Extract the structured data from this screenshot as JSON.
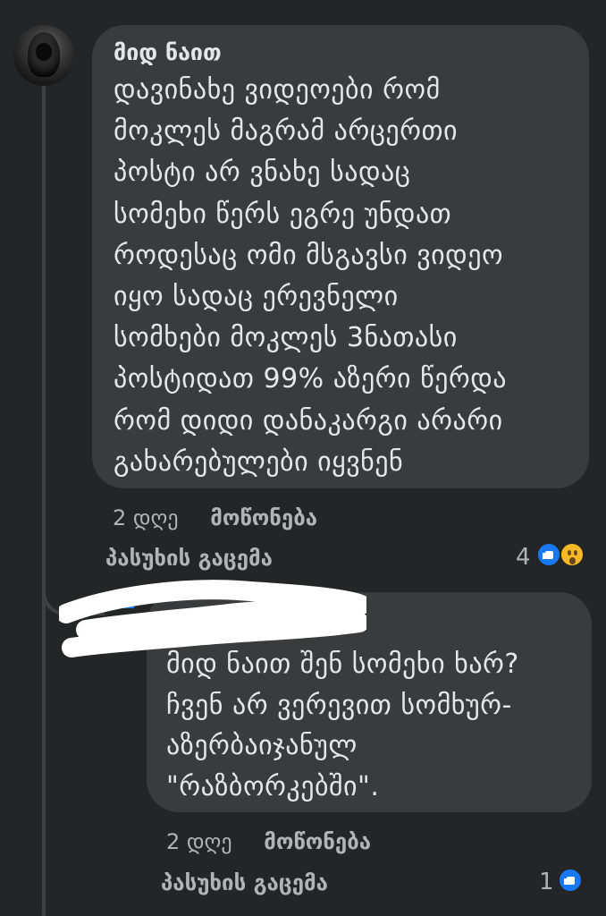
{
  "comment": {
    "author": "მიდ ნაით",
    "text": "დავინახე ვიდეოები რომ\nმოკლეს მაგრამ არცერთი\nპოსტი არ ვნახე სადაც\nსომეხი წერს ეგრე უნდათ\nროდესაც ომი  მსგავსი ვიდეო\nიყო სადაც ერევნელი\nსომხები მოკლეს 3ნათასი\nპოსტიდათ 99% აზერი წერდა\nრომ დიდი დანაკარგი არარი\nგახარებულები იყვნენ",
    "time": "2 დღე",
    "like_label": "მოწონება",
    "reply_label": "პასუხის გაცემა",
    "reaction_count": "4",
    "reactions": [
      "like-icon",
      "wow-icon"
    ]
  },
  "reply": {
    "text": "მიდ ნაით შენ სომეხი ხარ?\nჩვენ არ ვერევით სომხურ-\nაზერბაიჯანულ\n\"რაზბორკებში\".",
    "time": "2 დღე",
    "like_label": "მოწონება",
    "reply_label": "პასუხის გაცემა",
    "reaction_count": "1",
    "reactions": [
      "like-icon"
    ]
  },
  "colors": {
    "background": "#242526",
    "bubble": "#3a3b3c",
    "text_primary": "#e4e6eb",
    "text_secondary": "#b0b3b8",
    "like_blue": "#1877f2",
    "wow_yellow": "#f7b928"
  }
}
